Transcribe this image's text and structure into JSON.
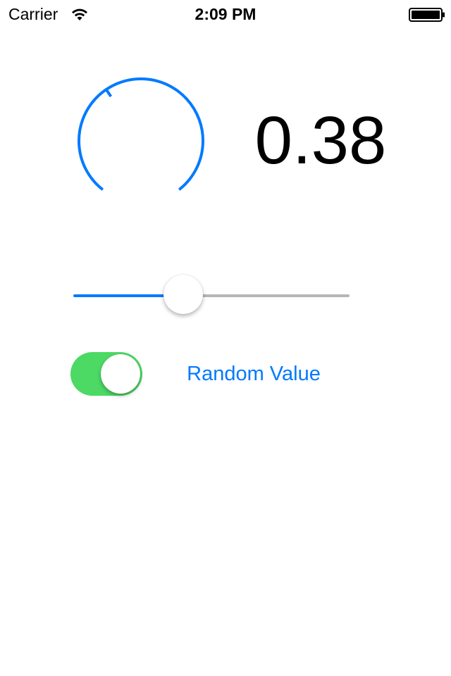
{
  "status_bar": {
    "carrier": "Carrier",
    "time": "2:09 PM",
    "wifi_icon": "wifi-icon",
    "battery_icon": "battery-icon"
  },
  "knob": {
    "value": 0.38,
    "value_text": "0.38",
    "accent_color": "#007aff"
  },
  "slider": {
    "value": 0.38,
    "min_track_color": "#007aff",
    "max_track_color": "#b6b6b6"
  },
  "toggle": {
    "on": true,
    "on_color": "#4cd964"
  },
  "random_button": {
    "label": "Random Value",
    "color": "#007aff"
  }
}
